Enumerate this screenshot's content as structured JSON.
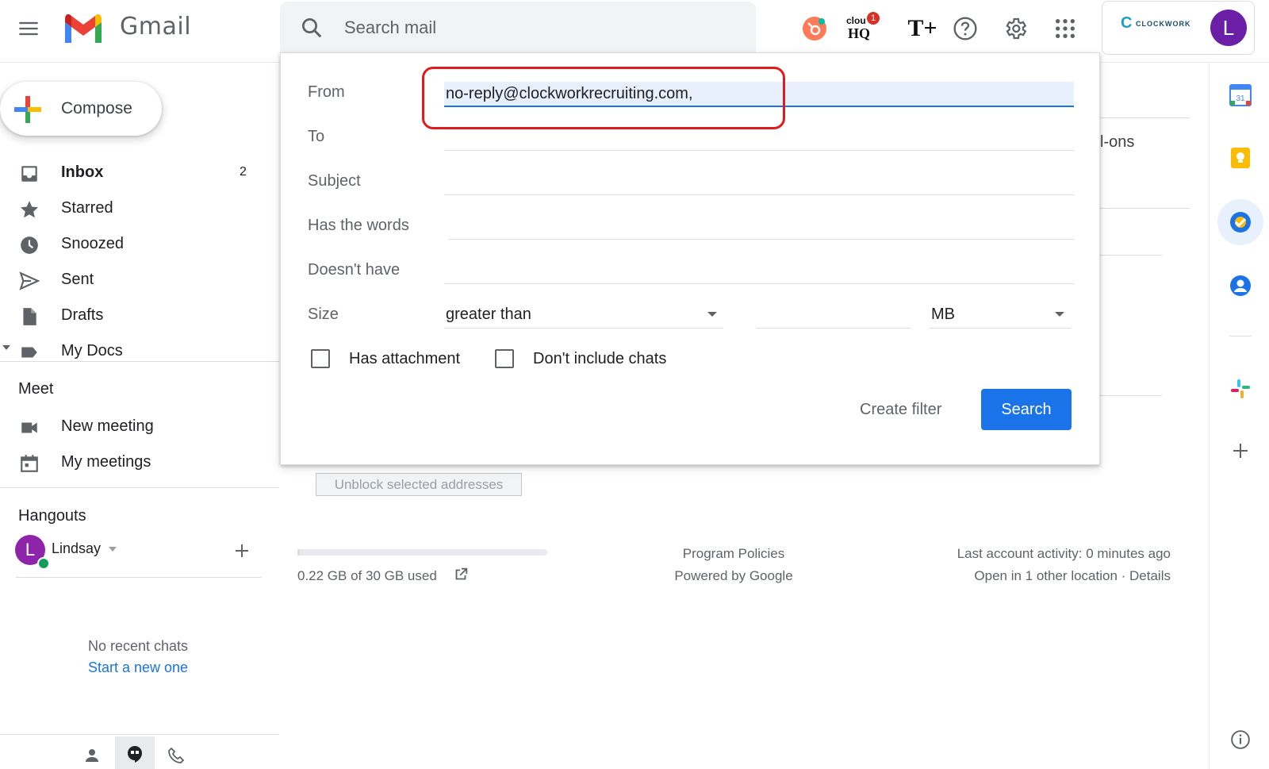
{
  "header": {
    "app_name": "Gmail",
    "search": {
      "placeholder": "Search mail"
    },
    "cloudhq_text": "clou",
    "cloudhq_sub": "HQ",
    "cloudhq_badge": "1",
    "tplus_text": "T+",
    "account_logo_text": "CLOCKWORK",
    "account_logo_letter": "C",
    "avatar_letter": "L"
  },
  "sidebar": {
    "compose_label": "Compose",
    "items": [
      {
        "label": "Inbox",
        "count": "2"
      },
      {
        "label": "Starred"
      },
      {
        "label": "Snoozed"
      },
      {
        "label": "Sent"
      },
      {
        "label": "Drafts"
      },
      {
        "label": "My Docs"
      }
    ],
    "meet": {
      "title": "Meet",
      "items": [
        {
          "label": "New meeting"
        },
        {
          "label": "My meetings"
        }
      ]
    },
    "hangouts": {
      "title": "Hangouts",
      "user_letter": "L",
      "user_name": "Lindsay",
      "no_chats": "No recent chats",
      "start_new": "Start a new one"
    }
  },
  "main": {
    "addons_fragment": "l-ons",
    "unblock_button": "Unblock selected addresses",
    "storage": {
      "used_text": "0.22 GB of 30 GB used",
      "fraction": 0.0073
    },
    "footer": {
      "program_policies": "Program Policies",
      "powered_by": "Powered by Google",
      "last_activity": "Last account activity: 0 minutes ago",
      "other_location": "Open in 1 other location · Details"
    }
  },
  "filter_dialog": {
    "from_label": "From",
    "from_value": "no-reply@clockworkrecruiting.com,",
    "to_label": "To",
    "subject_label": "Subject",
    "has_words_label": "Has the words",
    "doesnt_have_label": "Doesn't have",
    "size_label": "Size",
    "size_operator": "greater than",
    "size_unit": "MB",
    "has_attachment_label": "Has attachment",
    "no_chats_label": "Don't include chats",
    "create_filter_label": "Create filter",
    "search_button_label": "Search"
  },
  "right_rail": {
    "calendar_day": "31"
  },
  "colors": {
    "accent": "#1a73e8",
    "highlight": "#e01b1b",
    "avatar": "#6a1fa6"
  }
}
